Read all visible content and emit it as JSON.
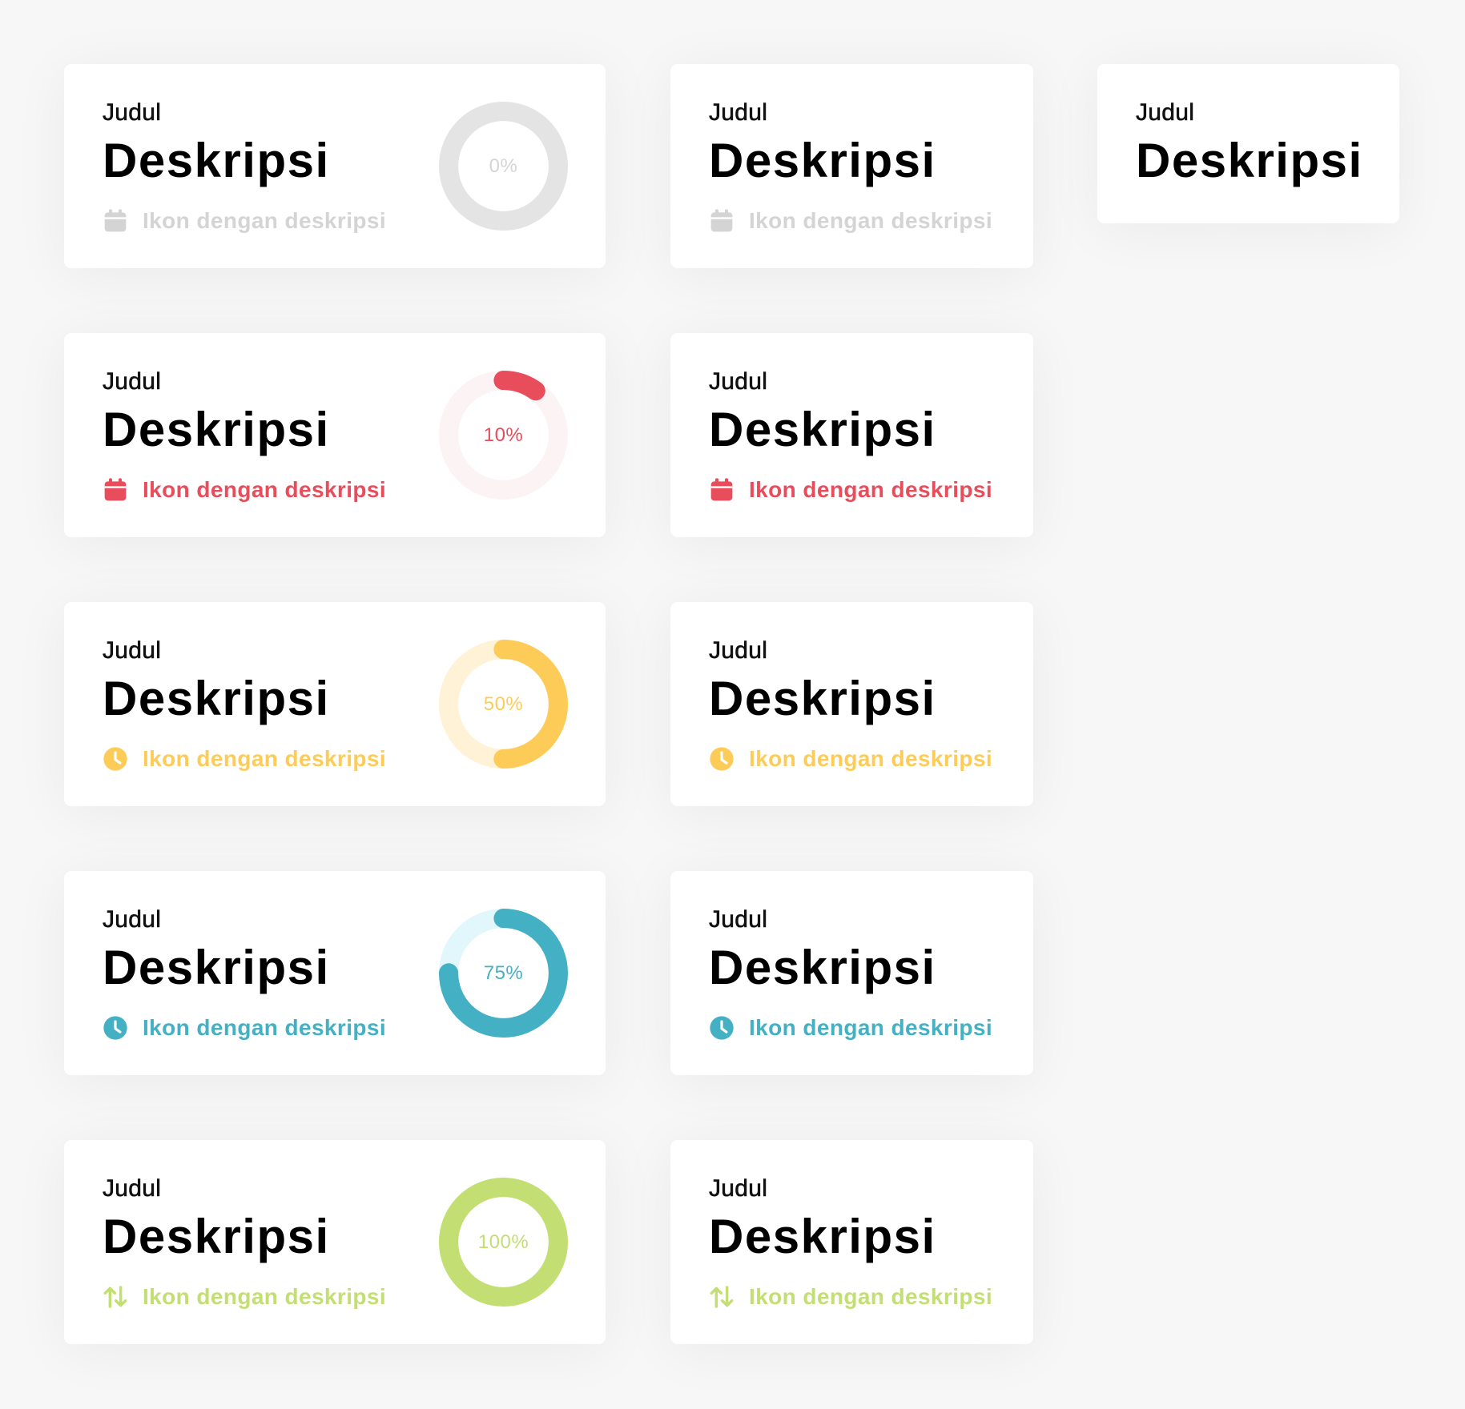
{
  "colors": {
    "gray": "#e4e4e4",
    "gray_text": "#d4d4d4",
    "red": "#e84d5b",
    "red_track": "#fbf3f4",
    "yellow": "#fdcc58",
    "yellow_track": "#fff2d6",
    "teal": "#44b0c4",
    "teal_track": "#e1f7fc",
    "green": "#c3de73"
  },
  "cards": [
    {
      "title": "Judul",
      "description": "Deskripsi",
      "meta_text": "Ikon dengan deskripsi",
      "meta_icon": "calendar-icon",
      "progress": 0,
      "progress_label": "0%",
      "color": "gray"
    },
    {
      "title": "Judul",
      "description": "Deskripsi",
      "meta_text": "Ikon dengan deskripsi",
      "meta_icon": "calendar-icon",
      "color": "gray"
    },
    {
      "title": "Judul",
      "description": "Deskripsi"
    },
    {
      "title": "Judul",
      "description": "Deskripsi",
      "meta_text": "Ikon dengan deskripsi",
      "meta_icon": "calendar-icon",
      "progress": 0.1,
      "progress_label": "10%",
      "color": "red"
    },
    {
      "title": "Judul",
      "description": "Deskripsi",
      "meta_text": "Ikon dengan deskripsi",
      "meta_icon": "calendar-icon",
      "color": "red"
    },
    {
      "title": "Judul",
      "description": "Deskripsi",
      "meta_text": "Ikon dengan deskripsi",
      "meta_icon": "clock-icon",
      "progress": 0.5,
      "progress_label": "50%",
      "color": "yellow"
    },
    {
      "title": "Judul",
      "description": "Deskripsi",
      "meta_text": "Ikon dengan deskripsi",
      "meta_icon": "clock-icon",
      "color": "yellow"
    },
    {
      "title": "Judul",
      "description": "Deskripsi",
      "meta_text": "Ikon dengan deskripsi",
      "meta_icon": "clock-icon",
      "progress": 0.75,
      "progress_label": "75%",
      "color": "teal"
    },
    {
      "title": "Judul",
      "description": "Deskripsi",
      "meta_text": "Ikon dengan deskripsi",
      "meta_icon": "clock-icon",
      "color": "teal"
    },
    {
      "title": "Judul",
      "description": "Deskripsi",
      "meta_text": "Ikon dengan deskripsi",
      "meta_icon": "swap-vertical-icon",
      "progress": 1,
      "progress_label": "100%",
      "color": "green"
    },
    {
      "title": "Judul",
      "description": "Deskripsi",
      "meta_text": "Ikon dengan deskripsi",
      "meta_icon": "swap-vertical-icon",
      "color": "green"
    }
  ]
}
